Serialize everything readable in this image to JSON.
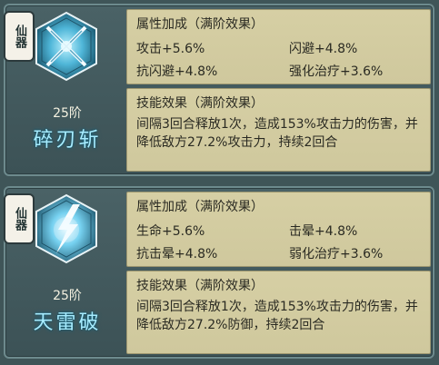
{
  "cards": [
    {
      "seal": "仙器",
      "level": "25阶",
      "name": "碎刃斩",
      "attr_title": "属性加成（满阶效果）",
      "stats": [
        "攻击+5.6%",
        "闪避+4.8%",
        "抗闪避+4.8%",
        "强化治疗+3.6%"
      ],
      "skill_title": "技能效果（满阶效果）",
      "skill_text": "间隔3回合释放1次，造成153%攻击力的伤害，并降低敌方27.2%攻击力，持续2回合"
    },
    {
      "seal": "仙器",
      "level": "25阶",
      "name": "天雷破",
      "attr_title": "属性加成（满阶效果）",
      "stats": [
        "生命+5.6%",
        "击晕+4.8%",
        "抗击晕+4.8%",
        "弱化治疗+3.6%"
      ],
      "skill_title": "技能效果（满阶效果）",
      "skill_text": "间隔3回合释放1次，造成153%攻击力的伤害，并降低敌方27.2%防御，持续2回合"
    }
  ]
}
